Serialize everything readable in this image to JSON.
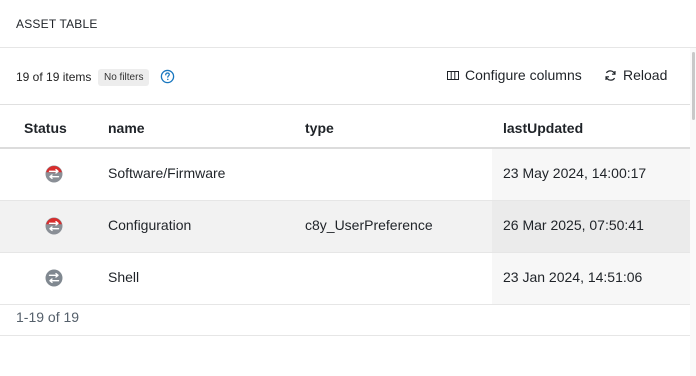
{
  "header": {
    "title": "ASSET TABLE"
  },
  "toolbar": {
    "item_count": "19 of 19 items",
    "filter_badge": "No filters",
    "configure_label": "Configure columns",
    "reload_label": "Reload"
  },
  "table": {
    "columns": [
      "Status",
      "name",
      "type",
      "lastUpdated"
    ],
    "rows": [
      {
        "status": "disconnected-red",
        "name": "Software/Firmware",
        "type": "",
        "lastUpdated": "23 May 2024, 14:00:17"
      },
      {
        "status": "disconnected-red",
        "name": "Configuration",
        "type": "c8y_UserPreference",
        "lastUpdated": "26 Mar 2025, 07:50:41"
      },
      {
        "status": "unknown-gray",
        "name": "Shell",
        "type": "",
        "lastUpdated": "23 Jan 2024, 14:51:06"
      }
    ]
  },
  "pager": {
    "label": "1-19 of 19"
  },
  "colors": {
    "status_red": "#d92d2d",
    "status_gray": "#808890",
    "help_blue": "#1776bf"
  }
}
